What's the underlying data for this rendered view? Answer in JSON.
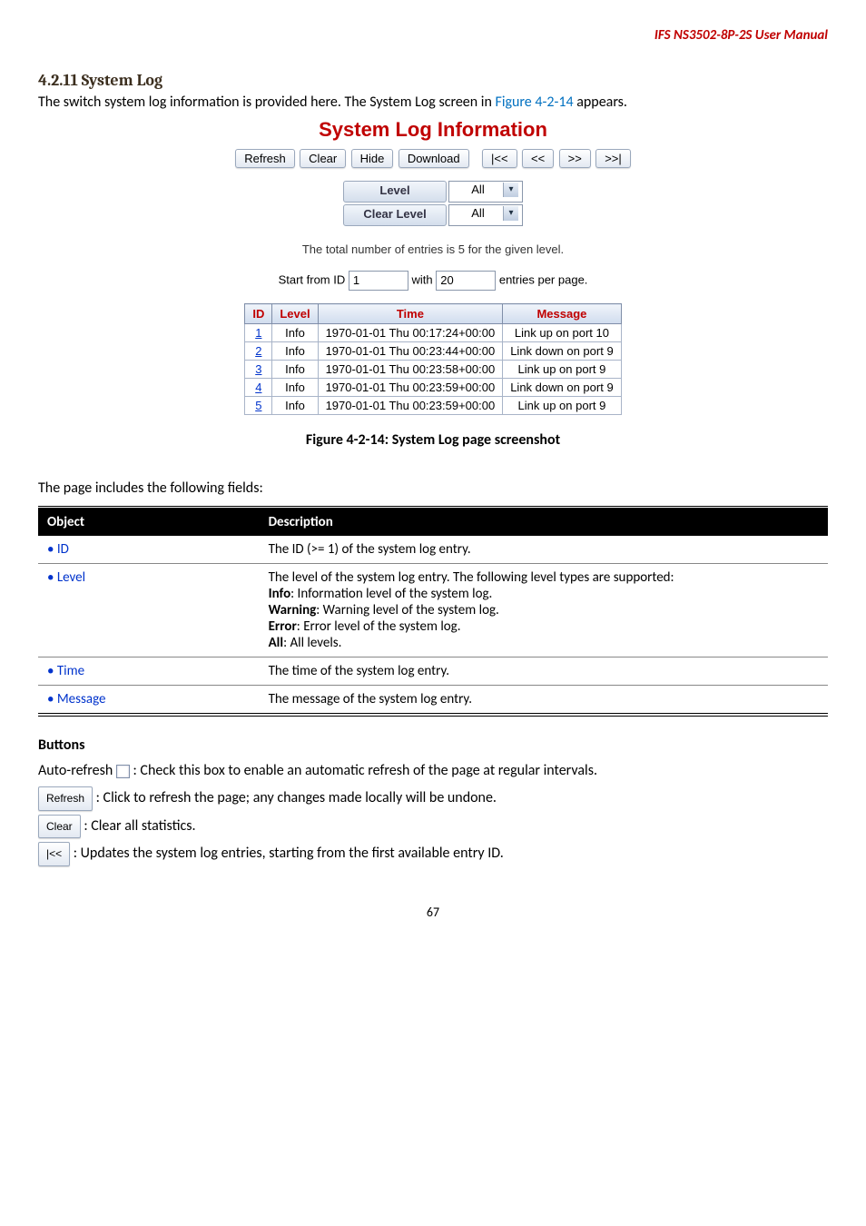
{
  "header": {
    "product": "IFS NS3502-8P-2S  User Manual"
  },
  "section": {
    "number_title": "4.2.11 System Log"
  },
  "intro": {
    "text_a": "The switch system log information is provided here. The System Log screen in ",
    "figref": "Figure 4-2-14",
    "text_b": " appears."
  },
  "figure": {
    "title": "System Log Information",
    "buttons": {
      "refresh": "Refresh",
      "clear": "Clear",
      "hide": "Hide",
      "download": "Download",
      "first": "|<<",
      "prev": "<<",
      "next": ">>",
      "last": ">>|"
    },
    "controls": {
      "level_btn": "Level",
      "level_sel": "All",
      "clear_btn": "Clear Level",
      "clear_sel": "All"
    },
    "total_note": "The total number of entries is 5 for the given level.",
    "startrow": {
      "a": "Start from ID ",
      "id_val": "1",
      "b": " with ",
      "with_val": "20",
      "c": " entries per page."
    },
    "logtbl": {
      "headers": {
        "id": "ID",
        "level": "Level",
        "time": "Time",
        "message": "Message"
      },
      "rows": [
        {
          "id": "1",
          "level": "Info",
          "time": "1970-01-01 Thu 00:17:24+00:00",
          "msg": "Link up on port 10"
        },
        {
          "id": "2",
          "level": "Info",
          "time": "1970-01-01 Thu 00:23:44+00:00",
          "msg": "Link down on port 9"
        },
        {
          "id": "3",
          "level": "Info",
          "time": "1970-01-01 Thu 00:23:58+00:00",
          "msg": "Link up on port 9"
        },
        {
          "id": "4",
          "level": "Info",
          "time": "1970-01-01 Thu 00:23:59+00:00",
          "msg": "Link down on port 9"
        },
        {
          "id": "5",
          "level": "Info",
          "time": "1970-01-01 Thu 00:23:59+00:00",
          "msg": "Link up on port 9"
        }
      ]
    }
  },
  "caption": {
    "label": "Figure 4-2-14:",
    "text": " System Log page screenshot"
  },
  "fields_intro": "The page includes the following fields:",
  "desc_tbl": {
    "headers": {
      "obj": "Object",
      "desc": "Description"
    },
    "rows": [
      {
        "obj": "• ID",
        "parts": [
          "The ID (>= 1) of the system log entry."
        ]
      },
      {
        "obj": "• Level",
        "parts": [
          "The level of the system log entry. The following level types are supported:",
          "",
          "Info",
          ": Information level of the system log.",
          "",
          "Warning",
          ": Warning level of the system log.",
          "",
          "Error",
          ": Error level of the system log.",
          "",
          "All",
          ": All levels."
        ]
      },
      {
        "obj": "• Time",
        "parts": [
          "The time of the system log entry."
        ]
      },
      {
        "obj": "• Message",
        "parts": [
          "The message of the system log entry."
        ]
      }
    ]
  },
  "buttons_section": {
    "heading": "Buttons",
    "auto_refresh": {
      "a": "Auto-refresh ",
      "b": " : Check this box to enable an automatic refresh of the page at regular intervals."
    },
    "refresh": {
      "btn": "Refresh",
      "t": ": Click to refresh the page; any changes made locally will be undone."
    },
    "clear": {
      "btn": "Clear",
      "t": ": Clear all statistics."
    },
    "first": {
      "btn": "|<<",
      "t": ": Updates the system log entries, starting from the first available entry ID."
    }
  },
  "footer": {
    "page": "67"
  }
}
